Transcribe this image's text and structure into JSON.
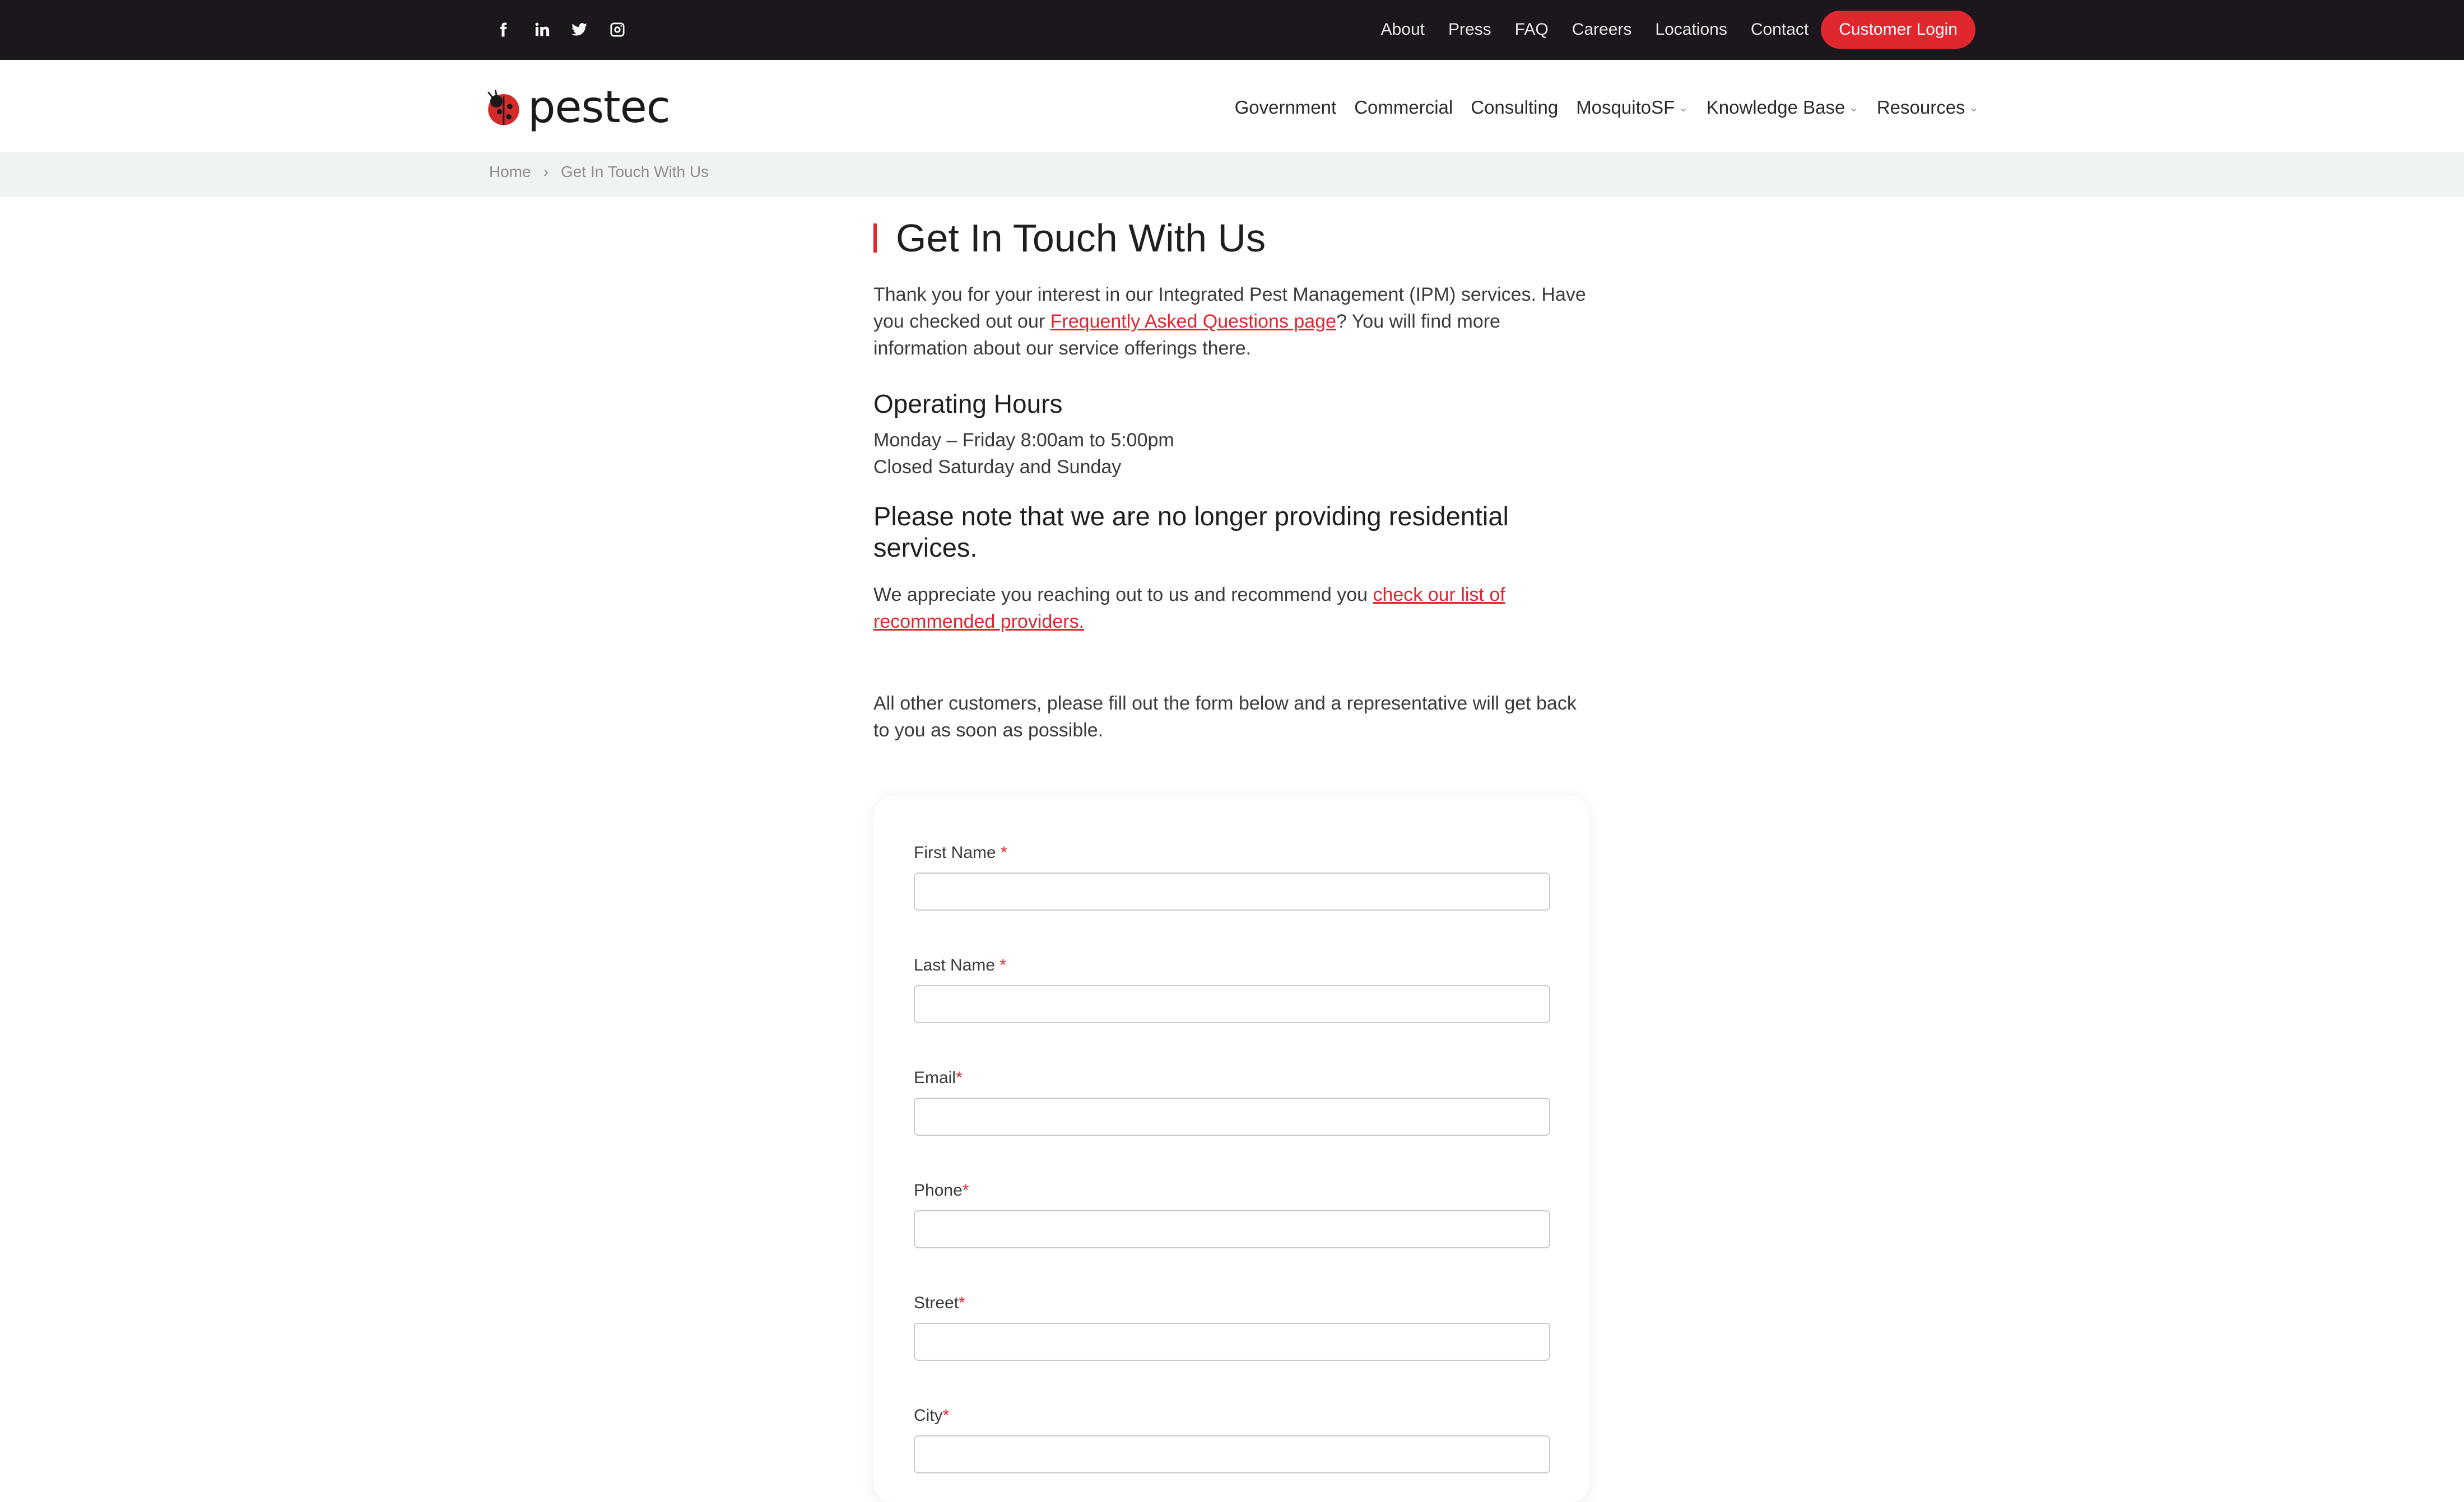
{
  "topbar": {
    "social": [
      "facebook-icon",
      "linkedin-icon",
      "twitter-icon",
      "instagram-icon"
    ],
    "links": [
      "About",
      "Press",
      "FAQ",
      "Careers",
      "Locations",
      "Contact"
    ],
    "login_label": "Customer Login"
  },
  "header": {
    "logo_text": "pestec",
    "nav": [
      {
        "label": "Government"
      },
      {
        "label": "Commercial"
      },
      {
        "label": "Consulting"
      },
      {
        "label": "MosquitoSF"
      },
      {
        "label": "Knowledge Base"
      },
      {
        "label": "Resources"
      }
    ]
  },
  "breadcrumb": {
    "home": "Home",
    "current": "Get In Touch With Us"
  },
  "content": {
    "title": "Get In Touch With Us",
    "intro_before": "Thank you for your interest in our Integrated Pest Management (IPM) services. Have you checked out our ",
    "intro_link": "Frequently Asked Questions page",
    "intro_after": "? You will find more information about our service offerings there.",
    "hours_heading": "Operating Hours",
    "hours_weekday": "Monday – Friday 8:00am to 5:00pm",
    "hours_closed": "Closed Saturday and Sunday",
    "notice_heading": "Please note that we are no longer providing residential services.",
    "notice_before": "We appreciate you reaching out to us and recommend you ",
    "notice_link": "check our list of recommended providers.",
    "form_intro": "All other customers, please fill out the form below and a representative will get back to you as soon as possible."
  },
  "form": {
    "fields": [
      {
        "label": "First Name ",
        "required": "*",
        "value": ""
      },
      {
        "label": "Last Name ",
        "required": "*",
        "value": ""
      },
      {
        "label": "Email",
        "required": "*",
        "value": ""
      },
      {
        "label": "Phone",
        "required": "*",
        "value": ""
      },
      {
        "label": "Street",
        "required": "*",
        "value": ""
      },
      {
        "label": "City",
        "required": "*",
        "value": ""
      }
    ]
  },
  "colors": {
    "accent": "#e0262f",
    "topbar": "#1c171d",
    "crumbbar": "#f0f3f4"
  }
}
